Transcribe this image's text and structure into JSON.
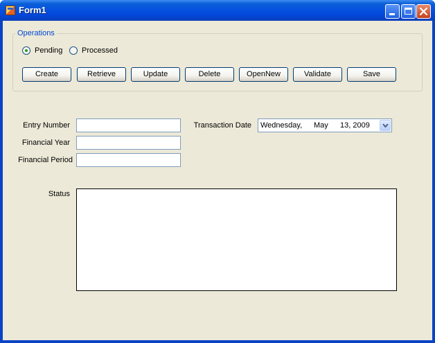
{
  "window": {
    "title": "Form1",
    "controls": {
      "minimize": "minimize-icon",
      "maximize": "maximize-icon",
      "close": "close-icon"
    }
  },
  "operations": {
    "legend": "Operations",
    "radios": [
      {
        "label": "Pending",
        "checked": true
      },
      {
        "label": "Processed",
        "checked": false
      }
    ],
    "buttons": [
      "Create",
      "Retrieve",
      "Update",
      "Delete",
      "OpenNew",
      "Validate",
      "Save"
    ]
  },
  "fields": {
    "entry_number": {
      "label": "Entry Number",
      "value": ""
    },
    "financial_year": {
      "label": "Financial Year",
      "value": ""
    },
    "financial_period": {
      "label": "Financial Period",
      "value": ""
    },
    "transaction_date": {
      "label": "Transaction Date",
      "weekday": "Wednesday,",
      "month": "May",
      "daydate": "13, 2009"
    },
    "status": {
      "label": "Status",
      "value": ""
    }
  },
  "colors": {
    "titlebar": "#0553e0",
    "form_bg": "#ece9d8",
    "group_legend": "#0046d5"
  }
}
